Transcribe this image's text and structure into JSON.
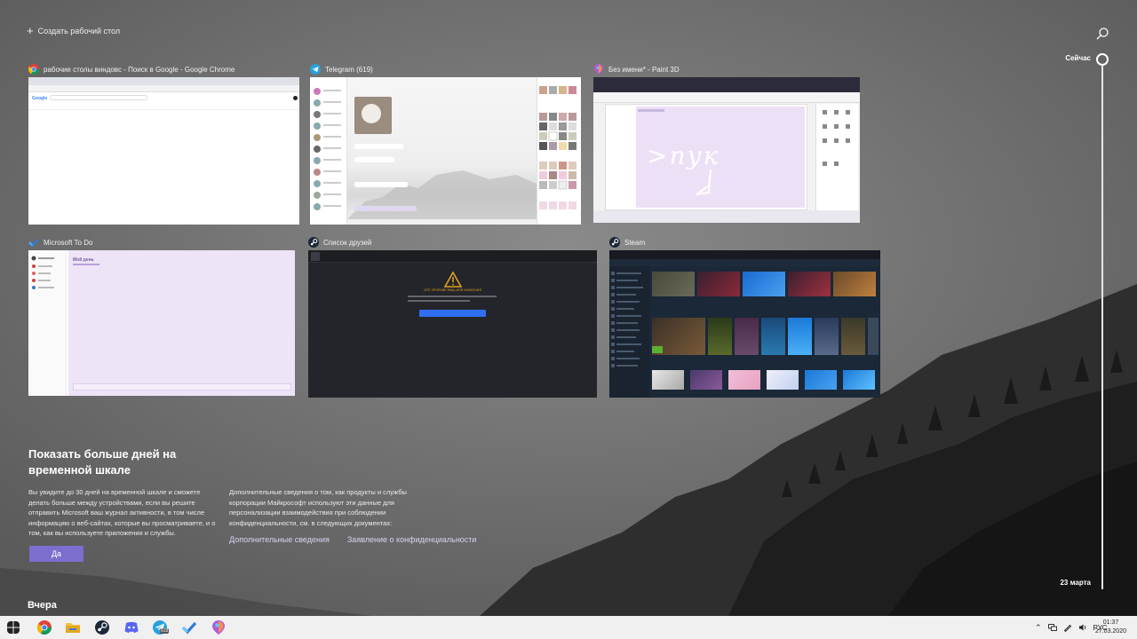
{
  "header": {
    "new_desktop_label": "Создать рабочий стол"
  },
  "timeline": {
    "now_label": "Сейчас",
    "date_label": "23 марта"
  },
  "windows": [
    {
      "title": "рабочие столы виндовс - Поиск в Google - Google Chrome",
      "icon": "chrome-icon"
    },
    {
      "title": "Telegram (619)",
      "icon": "telegram-icon"
    },
    {
      "title": "Без имени* - Paint 3D",
      "icon": "paint3d-icon"
    },
    {
      "title": "Microsoft To Do",
      "icon": "todo-icon"
    },
    {
      "title": "Список друзей",
      "icon": "steam-icon"
    },
    {
      "title": "Steam",
      "icon": "steam-icon"
    }
  ],
  "thumbs": {
    "paint_text": ">пук",
    "friends_error": "ОТЕ ЭРОРНИЕ ЯКАЬ ИПЯ ИСЕКОНИЯ",
    "todo_list": "Мой день",
    "google_logo": "Google"
  },
  "prompt": {
    "title": "Показать больше дней на временной шкале",
    "text1": "Вы увидите до 30 дней на временной шкале и сможете делать больше между устройствами, если вы решите отправить Microsoft ваш журнал активности, в том числе информацию о веб-сайтах, которые вы просматриваете, и о том, как вы используете приложения и службы.",
    "text2": "Дополнительные сведения о том, как продукты и службы корпорации Майкрософт используют эти данные для персонализации взаимодействия при соблюдении конфиденциальности, см. в следующих документах:",
    "link1": "Дополнительные сведения",
    "link2": "Заявление о конфиденциальности",
    "yes_button": "Да"
  },
  "section": {
    "yesterday": "Вчера"
  },
  "taskbar": {
    "lang": "РУС",
    "time": "01:37",
    "date": "27.03.2020",
    "telegram_badge": "619"
  },
  "colors": {
    "accent": "#7a6fcf",
    "todo_bg": "#ede4f7",
    "steam_dark": "#1b2838"
  }
}
